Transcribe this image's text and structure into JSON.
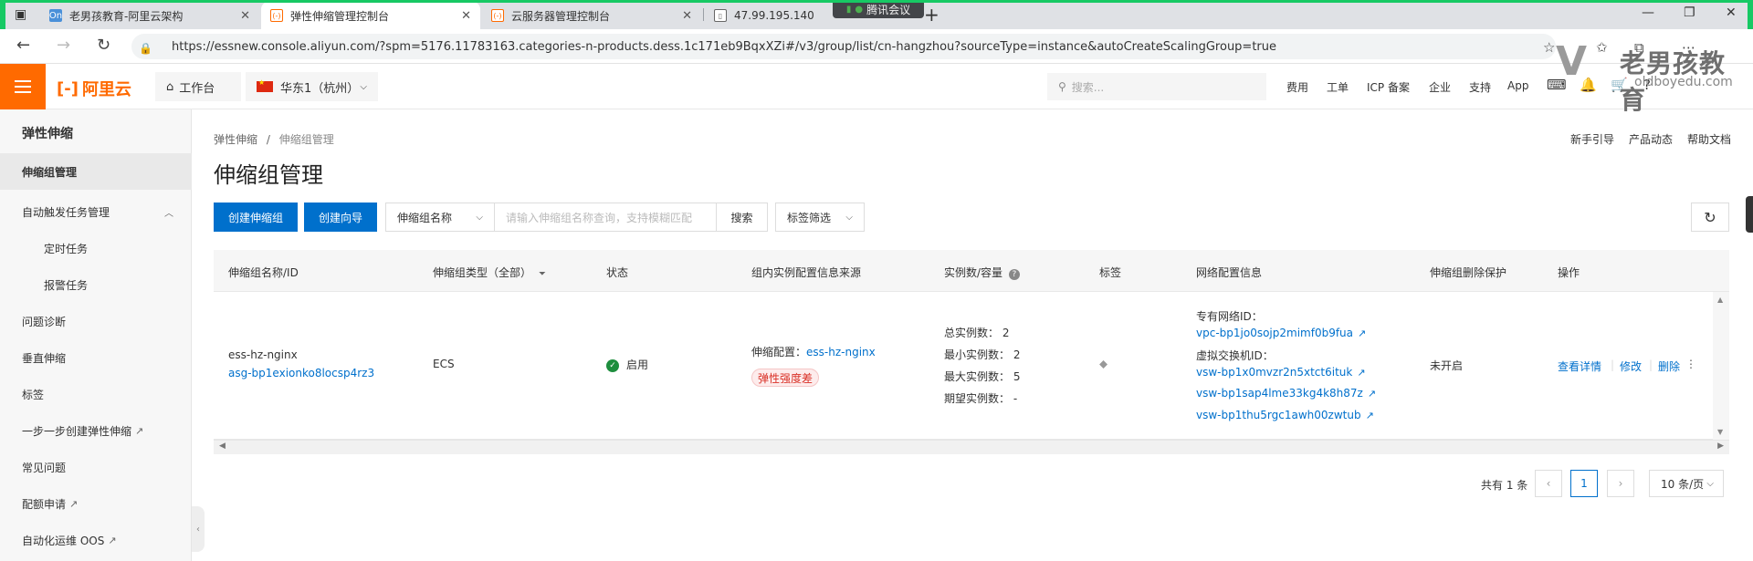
{
  "browser": {
    "tabs": [
      {
        "title": "老男孩教育-阿里云架构",
        "favicon": "On",
        "favicon_color": "#4a90d9"
      },
      {
        "title": "弹性伸缩管理控制台",
        "favicon": "(-)",
        "favicon_color": "#ff6a00"
      },
      {
        "title": "云服务器管理控制台",
        "favicon": "(-)",
        "favicon_color": "#ff6a00"
      },
      {
        "title": "47.99.195.140",
        "favicon": "doc",
        "favicon_color": "#666666"
      }
    ],
    "meeting_label": "腾讯会议",
    "url": "https://essnew.console.aliyun.com/?spm=5176.11783163.categories-n-products.dess.1c171eb9BqxXZi#/v3/group/list/cn-hangzhou?sourceType=instance&autoCreateScalingGroup=true"
  },
  "watermark": {
    "name": "老男孩教育",
    "site": "oldboyedu.com"
  },
  "topnav": {
    "logo": "阿里云",
    "workbench": "工作台",
    "region": "华东1（杭州）",
    "search_placeholder": "搜索...",
    "links": [
      "费用",
      "工单",
      "ICP 备案",
      "企业",
      "支持",
      "App"
    ]
  },
  "sidebar": {
    "title": "弹性伸缩",
    "items": [
      {
        "label": "伸缩组管理",
        "active": true
      },
      {
        "label": "自动触发任务管理"
      },
      {
        "label": "定时任务",
        "sub": true
      },
      {
        "label": "报警任务",
        "sub": true
      },
      {
        "label": "问题诊断"
      },
      {
        "label": "垂直伸缩"
      },
      {
        "label": "标签"
      },
      {
        "label": "一步一步创建弹性伸缩"
      },
      {
        "label": "常见问题"
      },
      {
        "label": "配额申请"
      },
      {
        "label": "自动化运维 OOS"
      }
    ]
  },
  "main": {
    "breadcrumb": {
      "root": "弹性伸缩",
      "sep": "/",
      "current": "伸缩组管理"
    },
    "top_links": [
      "新手引导",
      "产品动态",
      "帮助文档"
    ],
    "title": "伸缩组管理",
    "toolbar": {
      "create": "创建伸缩组",
      "wizard": "创建向导",
      "filter_field": "伸缩组名称",
      "search_placeholder": "请输入伸缩组名称查询，支持模糊匹配",
      "search": "搜索",
      "tag_filter": "标签筛选"
    },
    "columns": [
      "伸缩组名称/ID",
      "伸缩组类型（全部）",
      "状态",
      "组内实例配置信息来源",
      "实例数/容量",
      "标签",
      "网络配置信息",
      "伸缩组删除保护",
      "操作"
    ],
    "row": {
      "name": "ess-hz-nginx",
      "id": "asg-bp1exionko8locsp4rz3",
      "type": "ECS",
      "status": "启用",
      "config_label": "伸缩配置：",
      "config_name": "ess-hz-nginx",
      "elastic_tag": "弹性强度差",
      "counts": [
        "总实例数： 2",
        "最小实例数： 2",
        "最大实例数： 5",
        "期望实例数： -"
      ],
      "vpc_label": "专有网络ID：",
      "vpc_id": "vpc-bp1jo0sojp2mimf0b9fua",
      "vsw_label": "虚拟交换机ID：",
      "vsw_ids": [
        "vsw-bp1x0mvzr2n5xtct6ituk",
        "vsw-bp1sap4lme33kg4k8h87z",
        "vsw-bp1thu5rgc1awh00zwtub"
      ],
      "protection": "未开启",
      "actions": [
        "查看详情",
        "修改",
        "删除"
      ]
    },
    "pagination": {
      "total": "共有 1 条",
      "current": "1",
      "page_size": "10 条/页"
    }
  }
}
